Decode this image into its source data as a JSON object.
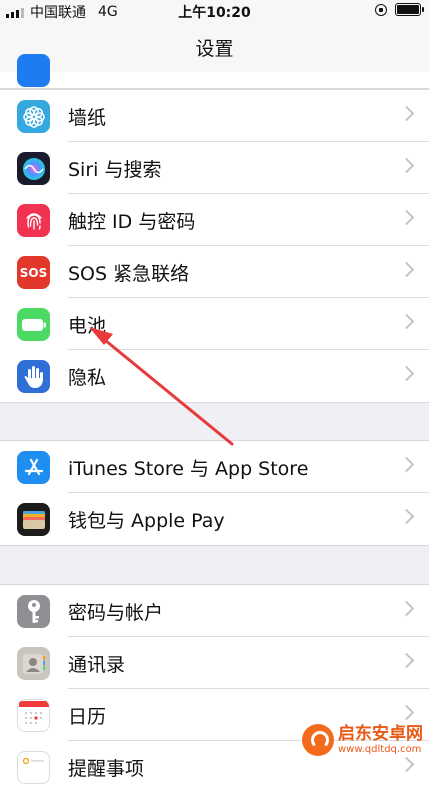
{
  "status_bar": {
    "carrier": "中国联通",
    "network": "4G",
    "time": "上午10:20"
  },
  "nav": {
    "title": "设置"
  },
  "groups": [
    {
      "rows": [
        {
          "label": "墙纸",
          "icon": "wallpaper-icon",
          "color": "#35a8df"
        },
        {
          "label": "Siri 与搜索",
          "icon": "siri-icon",
          "color": "#1b1b2e"
        },
        {
          "label": "触控 ID 与密码",
          "icon": "fingerprint-icon",
          "color": "#f2334f"
        },
        {
          "label": "SOS 紧急联络",
          "icon": "sos-icon",
          "color": "#e2382b",
          "icon_text": "SOS"
        },
        {
          "label": "电池",
          "icon": "battery-icon",
          "color": "#4cd964"
        },
        {
          "label": "隐私",
          "icon": "hand-icon",
          "color": "#2f6fd6"
        }
      ]
    },
    {
      "rows": [
        {
          "label": "iTunes Store 与 App Store",
          "icon": "app-store-icon",
          "color": "#1e8ef1"
        },
        {
          "label": "钱包与 Apple Pay",
          "icon": "wallet-icon",
          "color": "#1c1c1c"
        }
      ]
    },
    {
      "rows": [
        {
          "label": "密码与帐户",
          "icon": "key-icon",
          "color": "#8e8e93"
        },
        {
          "label": "通讯录",
          "icon": "contacts-icon",
          "color": "#c9c6c0"
        },
        {
          "label": "日历",
          "icon": "calendar-icon",
          "color": "#ffffff"
        },
        {
          "label": "提醒事项",
          "icon": "reminders-icon",
          "color": "#ffffff"
        }
      ]
    }
  ],
  "watermark": {
    "name": "启东安卓网",
    "url": "www.qdltdq.com"
  },
  "annotation": {
    "color": "#e8393b"
  }
}
